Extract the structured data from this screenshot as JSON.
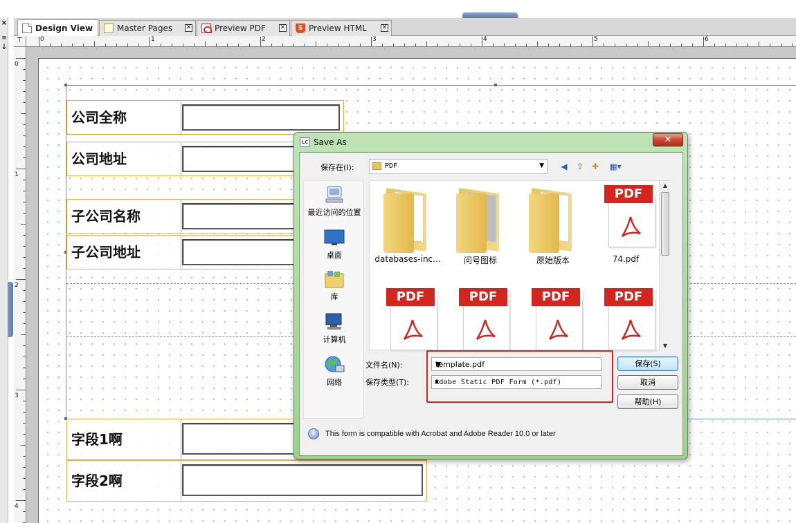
{
  "left_panel": {
    "close_glyph": "×",
    "menu_glyph": "≡",
    "arrow_glyph": "↓"
  },
  "tabs": [
    {
      "label": "Design View",
      "active": true
    },
    {
      "label": "Master Pages",
      "close": "✕"
    },
    {
      "label": "Preview PDF",
      "close": "✕"
    },
    {
      "label": "Preview HTML",
      "close": "✕"
    }
  ],
  "ruler": {
    "corner": "⊤",
    "top_numbers": [
      "0",
      "1",
      "2",
      "3",
      "4",
      "5",
      "6"
    ],
    "left_numbers": [
      "0",
      "1",
      "2",
      "3",
      "4"
    ]
  },
  "form_fields": [
    {
      "caption": "公司全称"
    },
    {
      "caption": "公司地址"
    },
    {
      "caption": "子公司名称"
    },
    {
      "caption": "子公司地址"
    },
    {
      "caption": "字段1啊"
    },
    {
      "caption": "字段2啊"
    }
  ],
  "dialog": {
    "title": "Save As",
    "app_icon": "LC",
    "close_glyph": "✕",
    "save_in_label": "保存在(I):",
    "save_in_value": "PDF",
    "places": [
      {
        "label": "最近访问的位置",
        "icon": "recent-places-icon"
      },
      {
        "label": "桌面",
        "icon": "desktop-icon"
      },
      {
        "label": "库",
        "icon": "libraries-icon"
      },
      {
        "label": "计算机",
        "icon": "computer-icon"
      },
      {
        "label": "网络",
        "icon": "network-icon"
      }
    ],
    "files": [
      {
        "name": "databases-inc...",
        "kind": "folder"
      },
      {
        "name": "问号图标",
        "kind": "folder"
      },
      {
        "name": "原始版本",
        "kind": "folder"
      },
      {
        "name": "74.pdf",
        "kind": "pdf"
      },
      {
        "name": "",
        "kind": "pdf"
      },
      {
        "name": "",
        "kind": "pdf"
      },
      {
        "name": "",
        "kind": "pdf"
      },
      {
        "name": "",
        "kind": "pdf"
      }
    ],
    "pdf_tag": "PDF",
    "file_name_label": "文件名(N):",
    "file_name_value": "template.pdf",
    "file_type_label": "保存类型(T):",
    "file_type_value": "Adobe Static PDF Form (*.pdf)",
    "buttons": {
      "save": "保存(S)",
      "cancel": "取消",
      "help": "帮助(H)"
    },
    "compat_text": "This form is compatible with Acrobat and Adobe Reader 10.0 or later",
    "colors": {
      "frame": "#a9d69c",
      "highlight": "#e0211b",
      "close_button": "#c8412b"
    }
  },
  "colors": {
    "field_border": "#f3a640",
    "subform_border": "#6d87c4",
    "pdf_red": "#d4261f"
  }
}
